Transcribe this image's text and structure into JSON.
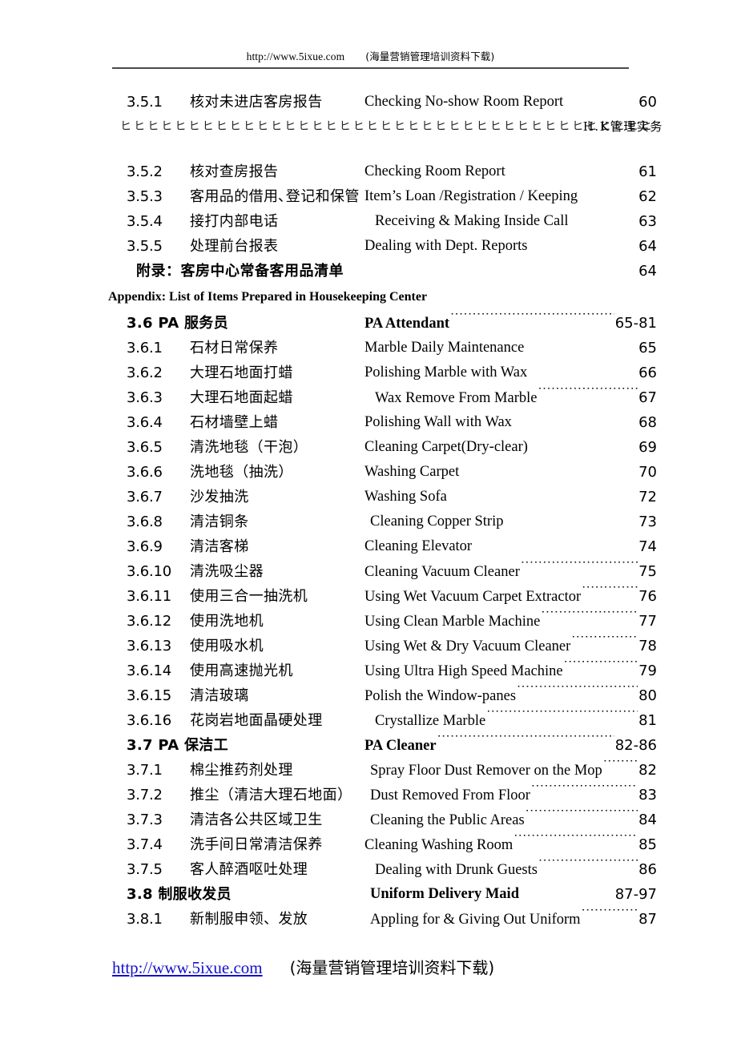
{
  "header": {
    "url": "http://www.5ixue.com",
    "note": "(海量营销管理培训资料下载)"
  },
  "footer": {
    "url": "http://www.5ixue.com",
    "note": "(海量营销管理培训资料下载)"
  },
  "artifact": {
    "glyphs": "ヒヒヒヒヒヒヒヒヒヒヒヒヒヒヒヒヒヒヒヒヒヒヒヒヒヒヒヒヒヒヒヒヒヒヒヒヒヒヒ",
    "tail": "H.K管理实务"
  },
  "toc": {
    "rows": [
      {
        "kind": "entry",
        "num": "3.5.1",
        "cn": "核对未进店客房报告",
        "en": "Checking No-show Room Report",
        "page": "60",
        "leader": false,
        "indent": 0
      },
      {
        "kind": "entry",
        "num": "3.5.2",
        "cn": "核对查房报告",
        "en": "Checking Room Report",
        "page": "61",
        "leader": false,
        "indent": 0
      },
      {
        "kind": "entry",
        "num": "3.5.3",
        "cn": "客用品的借用､登记和保管",
        "en": "Item’s Loan /Registration / Keeping",
        "page": "62",
        "leader": false,
        "indent": 0
      },
      {
        "kind": "entry",
        "num": "3.5.4",
        "cn": "接打内部电话",
        "en": "Receiving & Making Inside Call",
        "page": "63",
        "leader": false,
        "indent": 2
      },
      {
        "kind": "entry",
        "num": "3.5.5",
        "cn": "处理前台报表",
        "en": "Dealing with Dept. Reports",
        "page": "64",
        "leader": false,
        "indent": 0
      },
      {
        "kind": "appendix-cn",
        "cn": "附录：客房中心常备客用品清单",
        "page": "64"
      },
      {
        "kind": "appendix-en",
        "en": "Appendix: List of Items Prepared in Housekeeping Center"
      },
      {
        "kind": "section",
        "head": "3.6 PA 服务员",
        "en": "PA Attendant",
        "page": "65-81",
        "leader": true,
        "indent": 0
      },
      {
        "kind": "entry",
        "num": "3.6.1",
        "cn": "石材日常保养",
        "en": "Marble Daily Maintenance",
        "page": "65",
        "leader": false,
        "indent": 0
      },
      {
        "kind": "entry",
        "num": "3.6.2",
        "cn": "大理石地面打蜡",
        "en": "Polishing Marble with Wax",
        "page": "66",
        "leader": false,
        "indent": 0
      },
      {
        "kind": "entry",
        "num": "3.6.3",
        "cn": "大理石地面起蜡",
        "en": "Wax Remove From Marble ",
        "page": "67",
        "leader": true,
        "indent": 2
      },
      {
        "kind": "entry",
        "num": "3.6.4",
        "cn": "石材墙壁上蜡",
        "en": "Polishing Wall with Wax",
        "page": "68",
        "leader": false,
        "indent": 0
      },
      {
        "kind": "entry",
        "num": "3.6.5",
        "cn": "清洗地毯（干泡）",
        "en": "Cleaning Carpet(Dry-clear)",
        "page": "69",
        "leader": false,
        "indent": 0
      },
      {
        "kind": "entry",
        "num": "3.6.6",
        "cn": "洗地毯（抽洗）",
        "en": "Washing Carpet",
        "page": "70",
        "leader": false,
        "indent": 0
      },
      {
        "kind": "entry",
        "num": "3.6.7",
        "cn": "沙发抽洗",
        "en": "Washing Sofa",
        "page": "72",
        "leader": false,
        "indent": 0
      },
      {
        "kind": "entry",
        "num": "3.6.8",
        "cn": "清洁铜条",
        "en": "Cleaning Copper Strip",
        "page": "73",
        "leader": false,
        "indent": 1
      },
      {
        "kind": "entry",
        "num": "3.6.9",
        "cn": "清洁客梯",
        "en": "Cleaning Elevator",
        "page": "74",
        "leader": false,
        "indent": 0
      },
      {
        "kind": "entry",
        "num": "3.6.10",
        "cn": "清洗吸尘器",
        "en": "Cleaning Vacuum Cleaner",
        "page": "75",
        "leader": true,
        "indent": 0
      },
      {
        "kind": "entry",
        "num": "3.6.11",
        "cn": "使用三合一抽洗机",
        "en": "Using Wet Vacuum Carpet Extractor",
        "page": "76",
        "leader": true,
        "indent": 0
      },
      {
        "kind": "entry",
        "num": "3.6.12",
        "cn": "使用洗地机",
        "en": "Using Clean Marble Machine",
        "page": "77",
        "leader": true,
        "indent": 0
      },
      {
        "kind": "entry",
        "num": "3.6.13",
        "cn": "使用吸水机",
        "en": "Using Wet & Dry Vacuum Cleaner",
        "page": "78",
        "leader": true,
        "indent": 0
      },
      {
        "kind": "entry",
        "num": "3.6.14",
        "cn": "使用高速抛光机",
        "en": "Using Ultra High Speed Machine",
        "page": "79",
        "leader": true,
        "indent": 0
      },
      {
        "kind": "entry",
        "num": "3.6.15",
        "cn": "清洁玻璃",
        "en": "Polish the Window-panes ",
        "page": "80",
        "leader": true,
        "indent": 0
      },
      {
        "kind": "entry",
        "num": "3.6.16",
        "cn": "花岗岩地面晶硬处理",
        "en": "Crystallize Marble",
        "page": "81",
        "leader": true,
        "indent": 2
      },
      {
        "kind": "section",
        "head": "3.7 PA 保洁工",
        "en": "PA Cleaner",
        "page": "82-86",
        "leader": true,
        "indent": 0
      },
      {
        "kind": "entry",
        "num": "3.7.1",
        "cn": "棉尘推药剂处理",
        "en": "Spray Floor Dust Remover on the Mop",
        "page": "82",
        "leader": true,
        "indent": 1
      },
      {
        "kind": "entry",
        "num": "3.7.2",
        "cn": "推尘（清洁大理石地面）",
        "en": "Dust Removed From Floor ",
        "page": "83",
        "leader": true,
        "indent": 1
      },
      {
        "kind": "entry",
        "num": "3.7.3",
        "cn": "清洁各公共区域卫生",
        "en": "Cleaning the Public Areas",
        "page": "84",
        "leader": true,
        "indent": 1
      },
      {
        "kind": "entry",
        "num": "3.7.4",
        "cn": "洗手间日常清洁保养",
        "en": "Cleaning Washing Room ",
        "page": "85",
        "leader": true,
        "indent": 0
      },
      {
        "kind": "entry",
        "num": "3.7.5",
        "cn": "客人醉酒呕吐处理",
        "en": "Dealing with Drunk Guests ",
        "page": "86",
        "leader": true,
        "indent": 2
      },
      {
        "kind": "section",
        "head": "3.8 制服收发员",
        "en": "Uniform Delivery Maid",
        "page": "87-97",
        "leader": false,
        "indent": 1
      },
      {
        "kind": "entry",
        "num": "3.8.1",
        "cn": "新制服申领、发放",
        "en": "Appling for & Giving Out Uniform ",
        "page": "87",
        "leader": true,
        "indent": 1
      }
    ]
  }
}
